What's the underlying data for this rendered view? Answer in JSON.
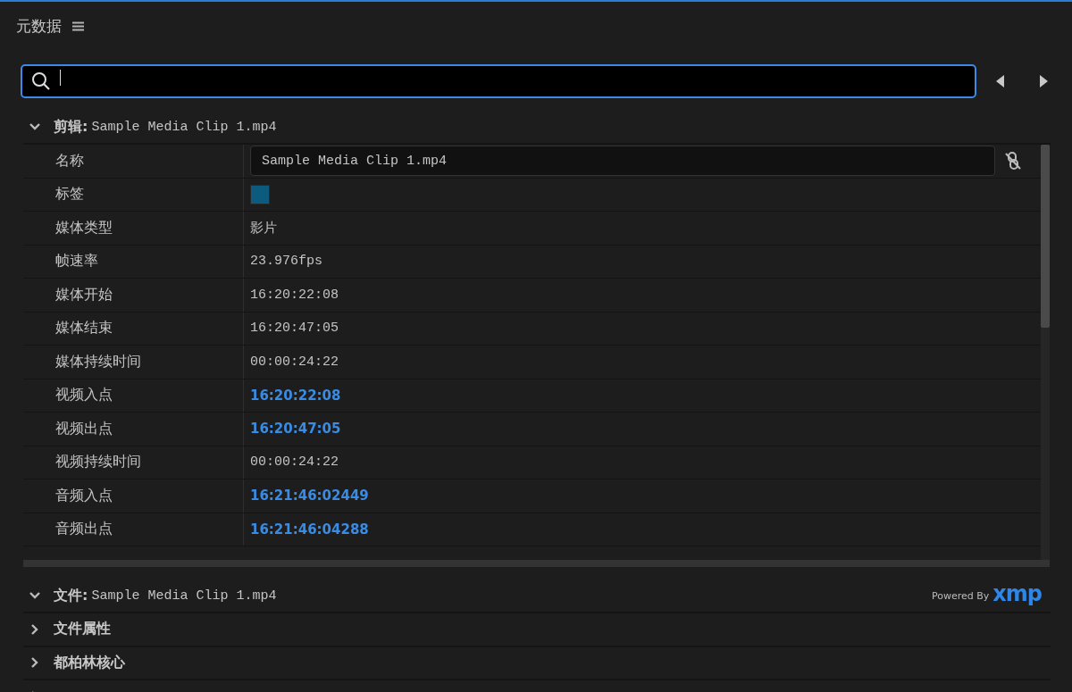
{
  "panel": {
    "title": "元数据"
  },
  "clip_section": {
    "label": "剪辑:",
    "value": "Sample Media Clip 1.mp4",
    "expanded": true,
    "rows": [
      {
        "kind": "input",
        "label": "名称",
        "value": "Sample Media Clip 1.mp4"
      },
      {
        "kind": "swatch",
        "label": "标签",
        "color": "#0d5a7f"
      },
      {
        "kind": "text",
        "label": "媒体类型",
        "value": "影片"
      },
      {
        "kind": "text",
        "label": "帧速率",
        "value": "23.976fps"
      },
      {
        "kind": "text",
        "label": "媒体开始",
        "value": "16:20:22:08"
      },
      {
        "kind": "text",
        "label": "媒体结束",
        "value": "16:20:47:05"
      },
      {
        "kind": "text",
        "label": "媒体持续时间",
        "value": "00:00:24:22"
      },
      {
        "kind": "link",
        "label": "视频入点",
        "value": "16:20:22:08"
      },
      {
        "kind": "link",
        "label": "视频出点",
        "value": "16:20:47:05"
      },
      {
        "kind": "text",
        "label": "视频持续时间",
        "value": "00:00:24:22"
      },
      {
        "kind": "link",
        "label": "音频入点",
        "value": "16:21:46:02449"
      },
      {
        "kind": "link",
        "label": "音频出点",
        "value": "16:21:46:04288"
      }
    ]
  },
  "file_section": {
    "label": "文件:",
    "value": "Sample Media Clip 1.mp4",
    "expanded": true,
    "powered_by": "Powered By",
    "logo": "xmp"
  },
  "groups": [
    {
      "label": "文件属性",
      "expanded": false
    },
    {
      "label": "都柏林核心",
      "expanded": false
    },
    {
      "expanded": false
    }
  ]
}
